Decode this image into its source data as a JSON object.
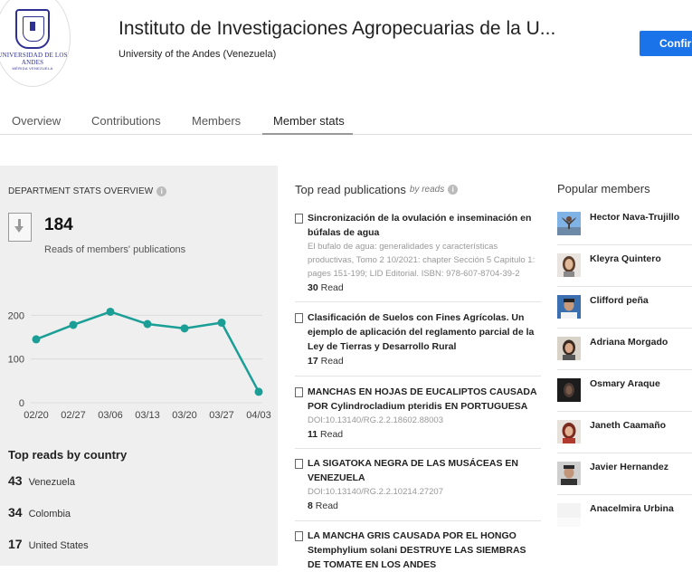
{
  "institution": {
    "title": "Instituto de Investigaciones Agropecuarias de la U...",
    "university": "University of the Andes (Venezuela)",
    "logo_text": "UNIVERSIDAD DE LOS ANDES",
    "logo_subtext": "MÉRIDA VENEZUELA",
    "confirm_label": "Confirm"
  },
  "tabs": [
    {
      "label": "Overview"
    },
    {
      "label": "Contributions"
    },
    {
      "label": "Members"
    },
    {
      "label": "Member stats",
      "active": true
    }
  ],
  "stats": {
    "heading": "DEPARTMENT STATS OVERVIEW",
    "reads_count": "184",
    "reads_label": "Reads of members' publications",
    "top_country_heading": "Top reads by country",
    "countries": [
      {
        "count": "43",
        "name": "Venezuela"
      },
      {
        "count": "34",
        "name": "Colombia"
      },
      {
        "count": "17",
        "name": "United States"
      }
    ]
  },
  "chart_data": {
    "type": "line",
    "x": [
      "02/20",
      "02/27",
      "03/06",
      "03/13",
      "03/20",
      "03/27",
      "04/03"
    ],
    "values": [
      145,
      178,
      208,
      180,
      170,
      183,
      25
    ],
    "ylim": [
      0,
      240
    ],
    "yticks": [
      "0",
      "100",
      "200"
    ],
    "color": "#1a9e96",
    "grid": true
  },
  "publications": {
    "heading": "Top read publications",
    "by_label": "by reads",
    "items": [
      {
        "title": "Sincronización de la ovulación e inseminación en búfalas de agua",
        "meta": "El bufalo de agua: generalidades y características productivas, Tomo 2 10/2021: chapter Sección 5 Capitulo 1: pages 151-199; LID Editorial. ISBN: 978-607-8704-39-2",
        "reads": "30",
        "reads_label": "Read"
      },
      {
        "title": "Clasificación de Suelos con Fines Agrícolas. Un ejemplo de aplicación del reglamento parcial de la Ley de Tierras y Desarrollo Rural",
        "meta": "",
        "reads": "17",
        "reads_label": "Read"
      },
      {
        "title": "MANCHAS EN HOJAS DE EUCALIPTOS CAUSADA POR Cylindrocladium pteridis EN PORTUGUESA",
        "meta": "DOI:10.13140/RG.2.2.18602.88003",
        "reads": "11",
        "reads_label": "Read"
      },
      {
        "title": "LA SIGATOKA NEGRA DE LAS MUSÁCEAS EN VENEZUELA",
        "meta": "DOI:10.13140/RG.2.2.10214.27207",
        "reads": "8",
        "reads_label": "Read"
      },
      {
        "title": "LA MANCHA GRIS CAUSADA POR EL HONGO Stemphylium solani DESTRUYE LAS SIEMBRAS DE TOMATE EN LOS ANDES",
        "meta": "",
        "reads": "",
        "reads_label": ""
      }
    ]
  },
  "members": {
    "heading": "Popular members",
    "items": [
      {
        "name": "Hector Nava-Trujillo"
      },
      {
        "name": "Kleyra Quintero"
      },
      {
        "name": "Clifford peña"
      },
      {
        "name": "Adriana Morgado"
      },
      {
        "name": "Osmary Araque"
      },
      {
        "name": "Janeth Caamaño"
      },
      {
        "name": "Javier Hernandez"
      },
      {
        "name": "Anacelmira Urbina"
      }
    ]
  }
}
